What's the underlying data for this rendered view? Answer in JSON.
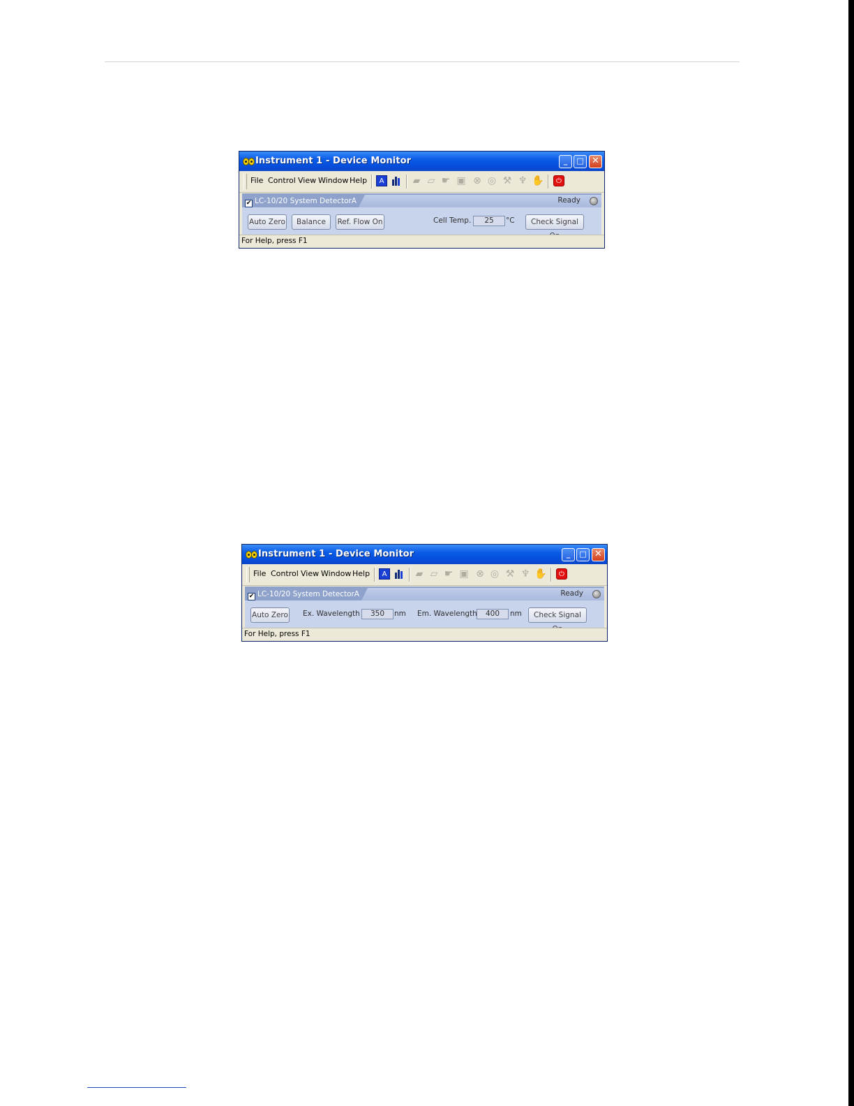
{
  "windows": [
    {
      "title": "Instrument 1 - Device Monitor",
      "menu": [
        "File",
        "Control",
        "View",
        "Window",
        "Help"
      ],
      "tab_label": "LC-10/20 System DetectorA",
      "status": "Ready",
      "buttons": [
        "Auto Zero",
        "Balance",
        "Ref. Flow On"
      ],
      "cell_temp_label": "Cell Temp. :",
      "cell_temp_value": "25",
      "cell_temp_unit": "°C",
      "check_signal": "Check Signal On",
      "status_bar": "For Help, press F1"
    },
    {
      "title": "Instrument 1 - Device Monitor",
      "menu": [
        "File",
        "Control",
        "View",
        "Window",
        "Help"
      ],
      "tab_label": "LC-10/20 System DetectorA",
      "status": "Ready",
      "auto_zero": "Auto Zero",
      "ex_label": "Ex. Wavelength :",
      "ex_value": "350",
      "ex_unit": "nm",
      "em_label": "Em. Wavelength :",
      "em_value": "400",
      "em_unit": "nm",
      "check_signal": "Check Signal On",
      "status_bar": "For Help, press F1"
    }
  ],
  "icons": {
    "app": "eyes-icon",
    "blue": "font-a-icon",
    "bars": "bar-chart-icon",
    "power": "power-icon"
  }
}
